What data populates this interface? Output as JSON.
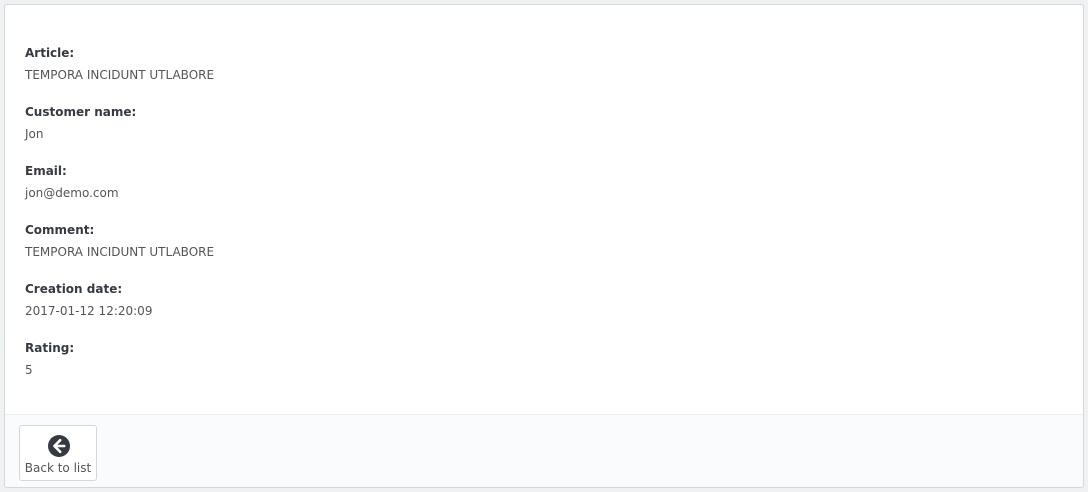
{
  "fields": [
    {
      "label": "Article:",
      "value": "TEMPORA INCIDUNT UTLABORE"
    },
    {
      "label": "Customer name:",
      "value": "Jon"
    },
    {
      "label": "Email:",
      "value": "jon@demo.com"
    },
    {
      "label": "Comment:",
      "value": "TEMPORA INCIDUNT UTLABORE"
    },
    {
      "label": "Creation date:",
      "value": "2017-01-12 12:20:09"
    },
    {
      "label": "Rating:",
      "value": "5"
    }
  ],
  "footer": {
    "back_label": "Back to list",
    "back_icon": "arrow-circle-left-icon"
  },
  "colors": {
    "label_text": "#363a41",
    "value_text": "#555555",
    "footer_bg": "#fafbfc",
    "icon": "#363a41"
  }
}
